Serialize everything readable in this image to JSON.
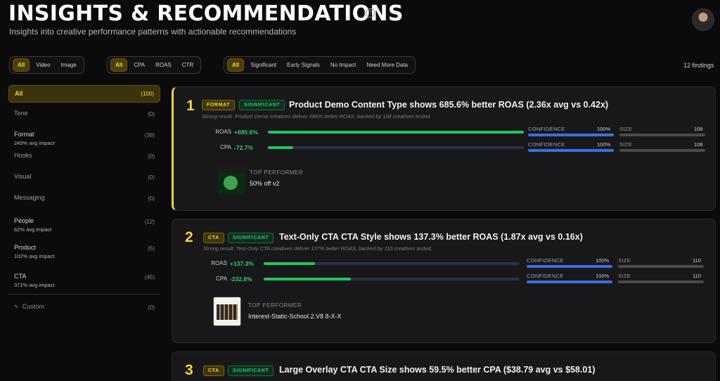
{
  "header": {
    "title": "INSIGHTS & RECOMMENDATIONS",
    "subtitle": "Insights into creative performance patterns with actionable recommendations",
    "help_icon": "?"
  },
  "filters": {
    "media": [
      "All",
      "Video",
      "Image"
    ],
    "metric": [
      "All",
      "CPA",
      "ROAS",
      "CTR"
    ],
    "significance": [
      "All",
      "Significant",
      "Early Signals",
      "No Impact",
      "Need More Data"
    ],
    "findings_count": "12 findings"
  },
  "sidebar": {
    "items": [
      {
        "label": "All",
        "count": "(100)",
        "impact": ""
      },
      {
        "label": "Tone",
        "count": "(0)",
        "impact": ""
      },
      {
        "label": "Format",
        "count": "(38)",
        "impact": "245% avg impact"
      },
      {
        "label": "Hooks",
        "count": "(0)",
        "impact": ""
      },
      {
        "label": "Visual",
        "count": "(0)",
        "impact": ""
      },
      {
        "label": "Messaging",
        "count": "(0)",
        "impact": ""
      },
      {
        "label": "People",
        "count": "(12)",
        "impact": "62% avg impact"
      },
      {
        "label": "Product",
        "count": "(5)",
        "impact": "102% avg impact"
      },
      {
        "label": "CTA",
        "count": "(45)",
        "impact": "371% avg impact"
      }
    ],
    "custom": {
      "label": "Custom",
      "count": "(0)",
      "icon": "✎"
    }
  },
  "cards": [
    {
      "rank": "1",
      "type_badge": "FORMAT",
      "sig_badge": "SIGNIFICANT",
      "title": "Product Demo Content Type shows 685.6% better ROAS (2.36x avg vs 0.42x)",
      "desc": "Strong result: Product Demo creatives deliver 686% better ROAS, backed by 108 creatives tested.",
      "metrics": [
        {
          "label": "ROAS",
          "value": "+685.6%",
          "fill": 1.0,
          "confidence_label": "CONFIDENCE",
          "confidence": "100%",
          "size_label": "SIZE",
          "size": "108"
        },
        {
          "label": "CPA",
          "value": "-72.7%",
          "fill": 0.1,
          "confidence_label": "CONFIDENCE",
          "confidence": "100%",
          "size_label": "SIZE",
          "size": "108"
        }
      ],
      "top_performer_label": "TOP PERFORMER",
      "top_performer": "50% off v2"
    },
    {
      "rank": "2",
      "type_badge": "CTA",
      "sig_badge": "SIGNIFICANT",
      "title": "Text-Only CTA CTA Style shows 137.3% better ROAS (1.87x avg vs 0.16x)",
      "desc": "Strong result: Text-Only CTA creatives deliver 137% better ROAS, backed by 110 creatives tested.",
      "metrics": [
        {
          "label": "ROAS",
          "value": "+137.3%",
          "fill": 0.2,
          "confidence_label": "CONFIDENCE",
          "confidence": "100%",
          "size_label": "SIZE",
          "size": "110"
        },
        {
          "label": "CPA",
          "value": "-232.8%",
          "fill": 0.34,
          "confidence_label": "CONFIDENCE",
          "confidence": "100%",
          "size_label": "SIZE",
          "size": "110"
        }
      ],
      "top_performer_label": "TOP PERFORMER",
      "top_performer": "Interest-Static-School.2.V8 8-X-X"
    },
    {
      "rank": "3",
      "type_badge": "CTA",
      "sig_badge": "SIGNIFICANT",
      "title": "Large Overlay CTA CTA Size shows 59.5% better CPA ($38.79 avg vs $58.01)"
    }
  ]
}
